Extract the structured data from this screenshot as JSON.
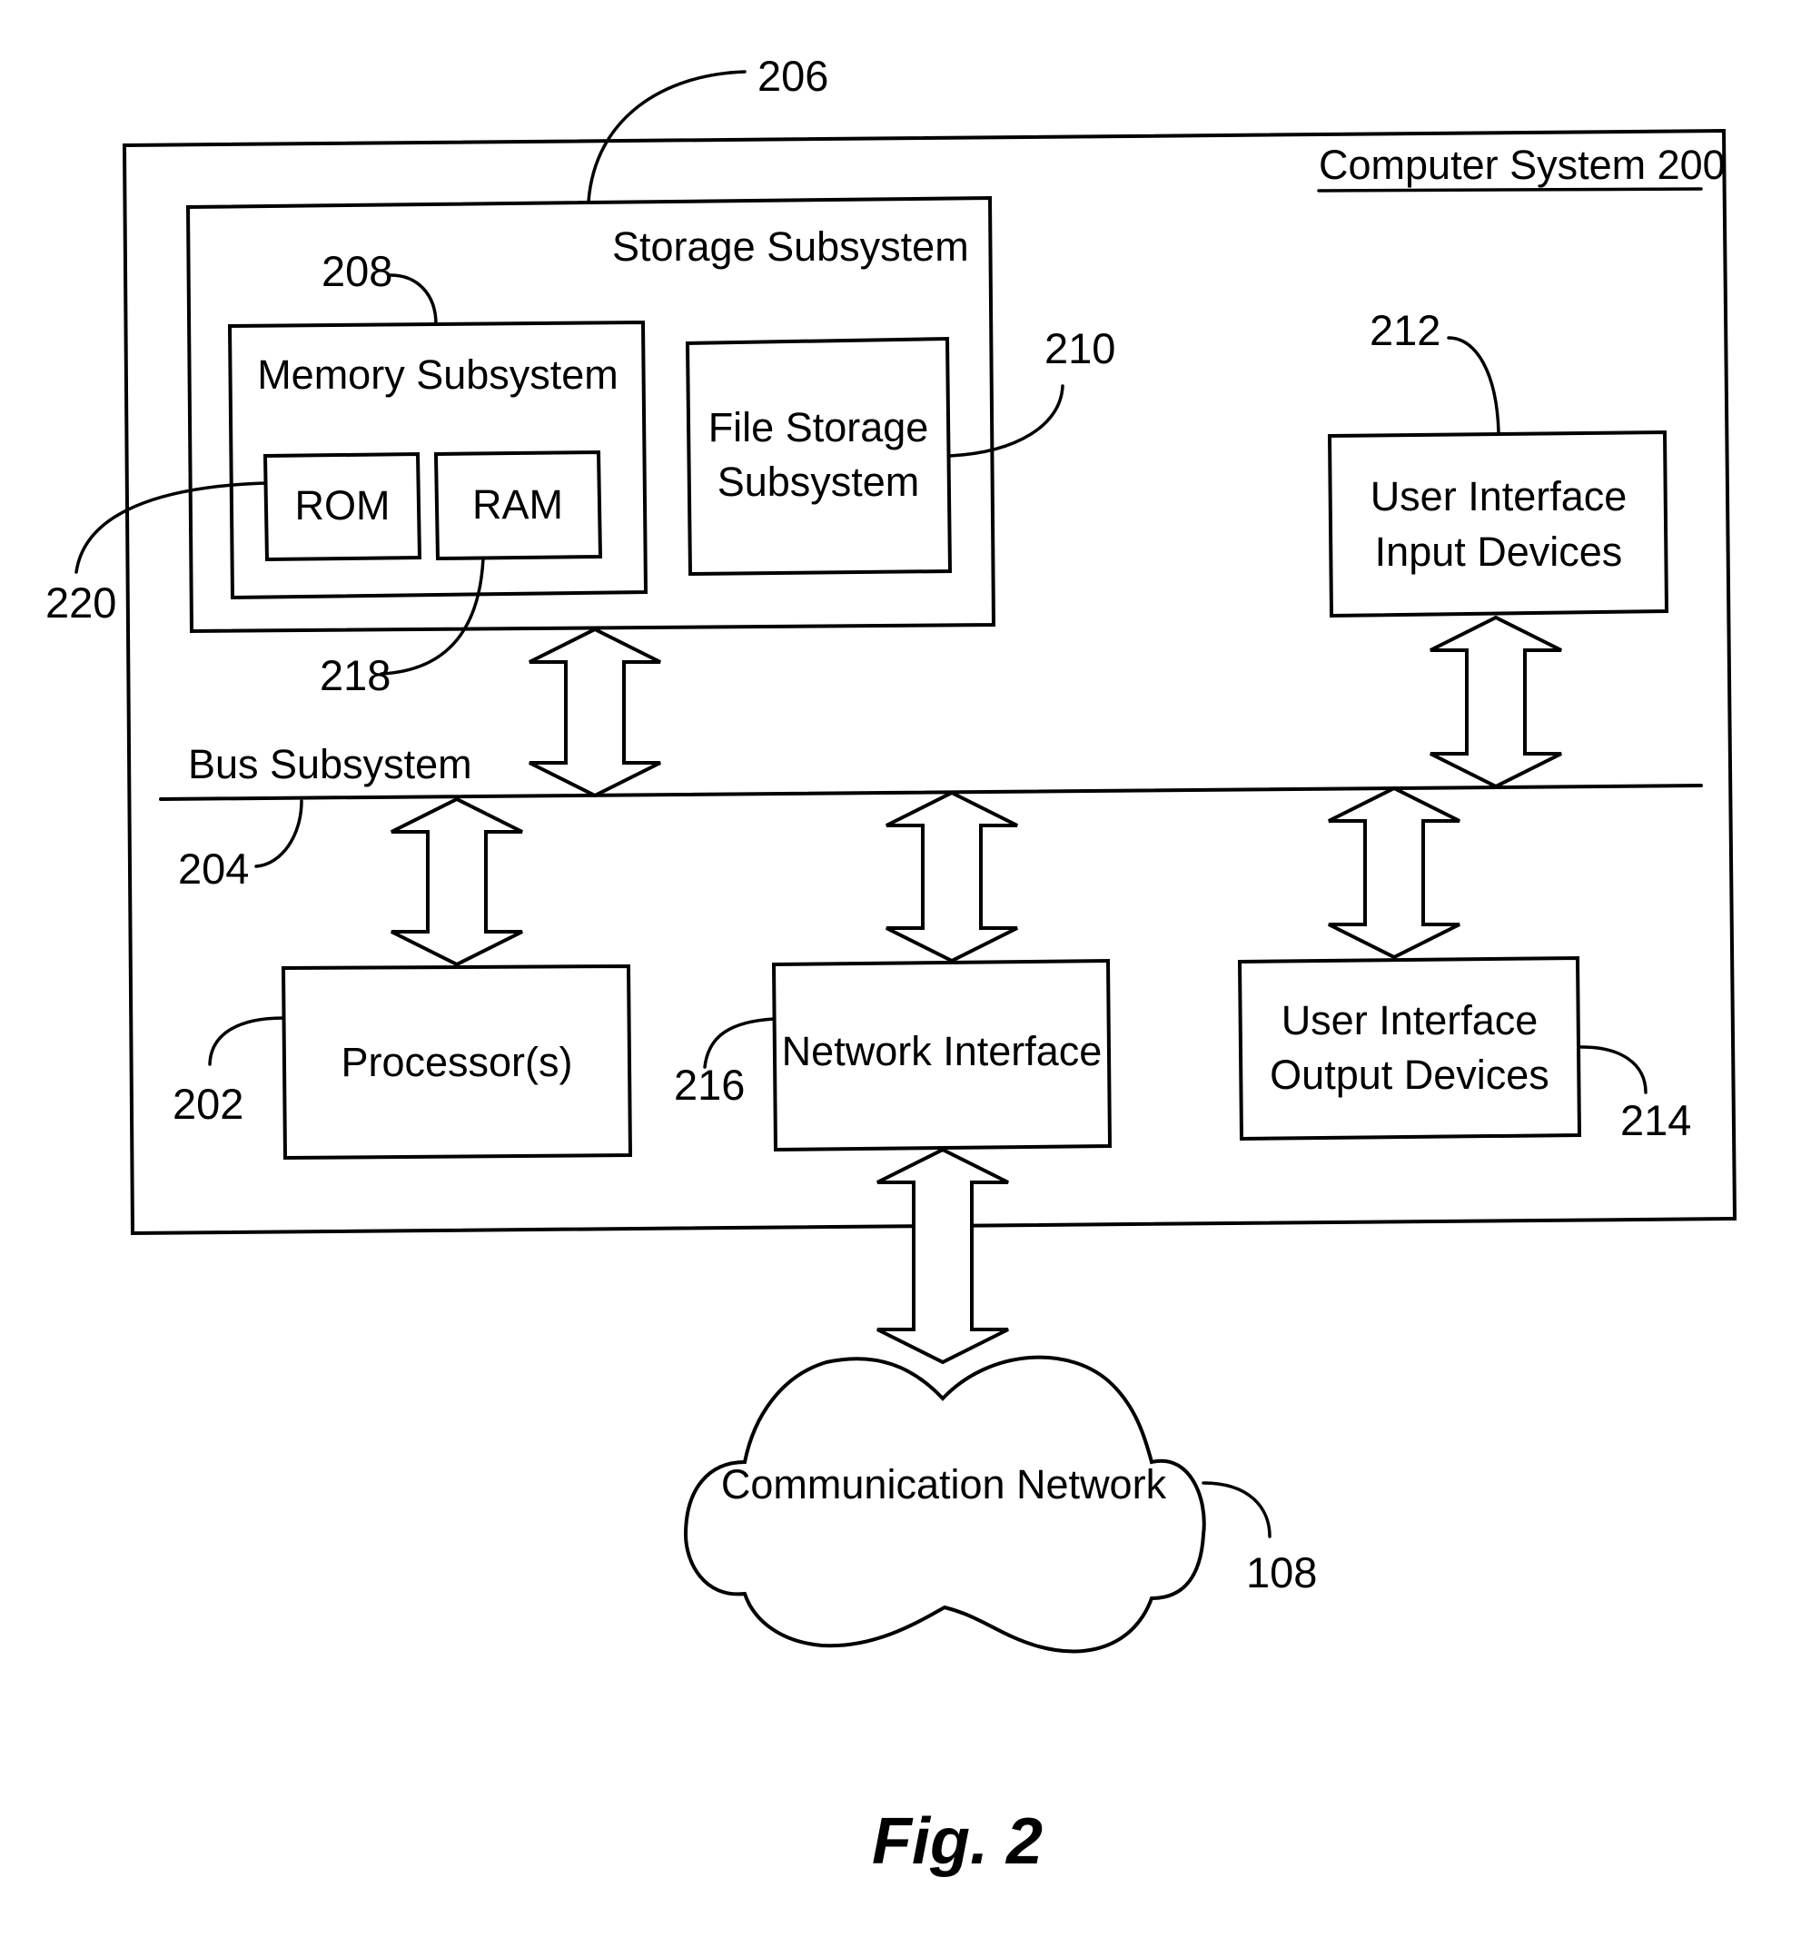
{
  "figure": {
    "caption": "Fig. 2",
    "system": {
      "label": "Computer System  200",
      "name": "Computer System",
      "ref": "200"
    },
    "blocks": {
      "storage": {
        "label": "Storage Subsystem",
        "ref": "206"
      },
      "memory": {
        "label": "Memory Subsystem",
        "ref": "208"
      },
      "rom": {
        "label": "ROM",
        "ref": "220"
      },
      "ram": {
        "label": "RAM",
        "ref": "218"
      },
      "file_storage": {
        "lines": [
          "File Storage",
          "Subsystem"
        ],
        "ref": "210"
      },
      "ui_input": {
        "lines": [
          "User Interface",
          "Input Devices"
        ],
        "ref": "212"
      },
      "bus": {
        "label": "Bus Subsystem",
        "ref": "204"
      },
      "processor": {
        "label": "Processor(s)",
        "ref": "202"
      },
      "network_interface": {
        "label": "Network Interface",
        "ref": "216"
      },
      "ui_output": {
        "lines": [
          "User Interface",
          "Output Devices"
        ],
        "ref": "214"
      },
      "network": {
        "label": "Communication Network",
        "ref": "108"
      }
    },
    "connections": [
      {
        "from": "storage",
        "to": "bus",
        "type": "bidirectional"
      },
      {
        "from": "ui_input",
        "to": "bus",
        "type": "bidirectional"
      },
      {
        "from": "processor",
        "to": "bus",
        "type": "bidirectional"
      },
      {
        "from": "network_interface",
        "to": "bus",
        "type": "bidirectional"
      },
      {
        "from": "ui_output",
        "to": "bus",
        "type": "bidirectional"
      },
      {
        "from": "network_interface",
        "to": "network",
        "type": "bidirectional"
      }
    ]
  }
}
